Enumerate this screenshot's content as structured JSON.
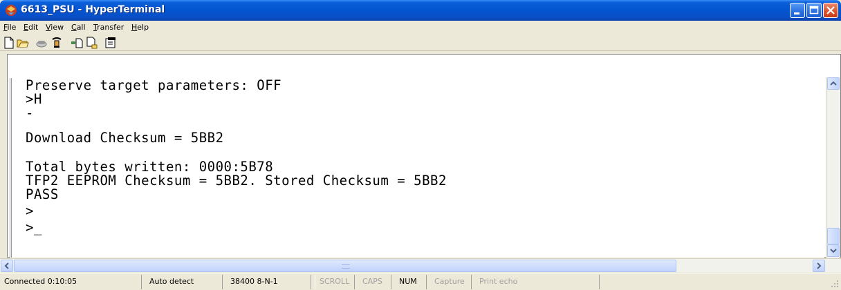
{
  "window": {
    "title": "6613_PSU - HyperTerminal",
    "icon": "hyperterminal-icon"
  },
  "menu": [
    {
      "label": "File",
      "accel": "F",
      "rest": "ile"
    },
    {
      "label": "Edit",
      "accel": "E",
      "rest": "dit"
    },
    {
      "label": "View",
      "accel": "V",
      "rest": "iew"
    },
    {
      "label": "Call",
      "accel": "C",
      "rest": "all"
    },
    {
      "label": "Transfer",
      "accel": "T",
      "rest": "ransfer"
    },
    {
      "label": "Help",
      "accel": "H",
      "rest": "elp"
    }
  ],
  "toolbar": [
    "new-icon",
    "open-icon",
    "connect-icon",
    "disconnect-icon",
    "send-icon",
    "receive-icon",
    "properties-icon"
  ],
  "terminal": {
    "lines": [
      "Preserve target parameters: OFF",
      ">H",
      "-",
      "Download Checksum = 5BB2",
      "",
      "Total bytes written: 0000:5B78",
      "TFP2 EEPROM Checksum = 5BB2. Stored Checksum = 5BB2",
      "PASS",
      ">",
      ">_"
    ]
  },
  "status": {
    "connected": "Connected 0:10:05",
    "detect": "Auto detect",
    "port": "38400 8-N-1",
    "scroll": "SCROLL",
    "caps": "CAPS",
    "num": "NUM",
    "capture": "Capture",
    "echo": "Print echo"
  },
  "colors": {
    "titlebar": "#0454d0",
    "close_button": "#d9532c"
  }
}
